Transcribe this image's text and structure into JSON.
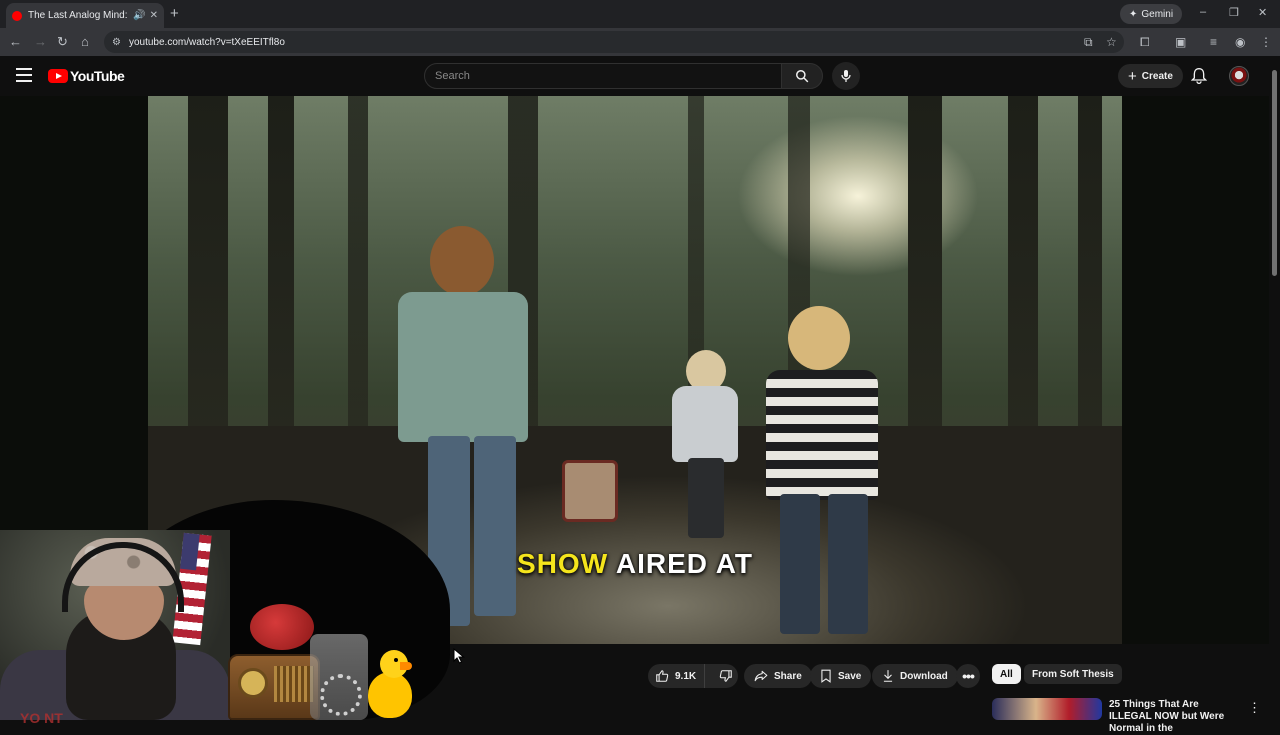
{
  "browser": {
    "tab_title": "The Last Analog Mind: A Pa",
    "new_tab": "+",
    "gemini_label": "Gemini",
    "url": "youtube.com/watch?v=tXeEEITfl8o",
    "window_min": "–",
    "window_restore": "❐",
    "window_close": "✕"
  },
  "youtube": {
    "logo_text": "YouTube",
    "search_placeholder": "Search",
    "create_label": "Create"
  },
  "video": {
    "caption_highlight": "SHOW",
    "caption_rest": "AIRED AT"
  },
  "overlay": {
    "shirt_text": "YO   NT"
  },
  "actions": {
    "like_count": "9.1K",
    "share_label": "Share",
    "save_label": "Save",
    "download_label": "Download"
  },
  "chips": [
    "All",
    "From Soft Thesis"
  ],
  "recommendation": {
    "title": "25 Things That Are ILLEGAL NOW but Were Normal in the"
  },
  "colors": {
    "background": "#0f0f0f",
    "youtube_red": "#ff0000",
    "caption_yellow": "#f5e51c"
  }
}
